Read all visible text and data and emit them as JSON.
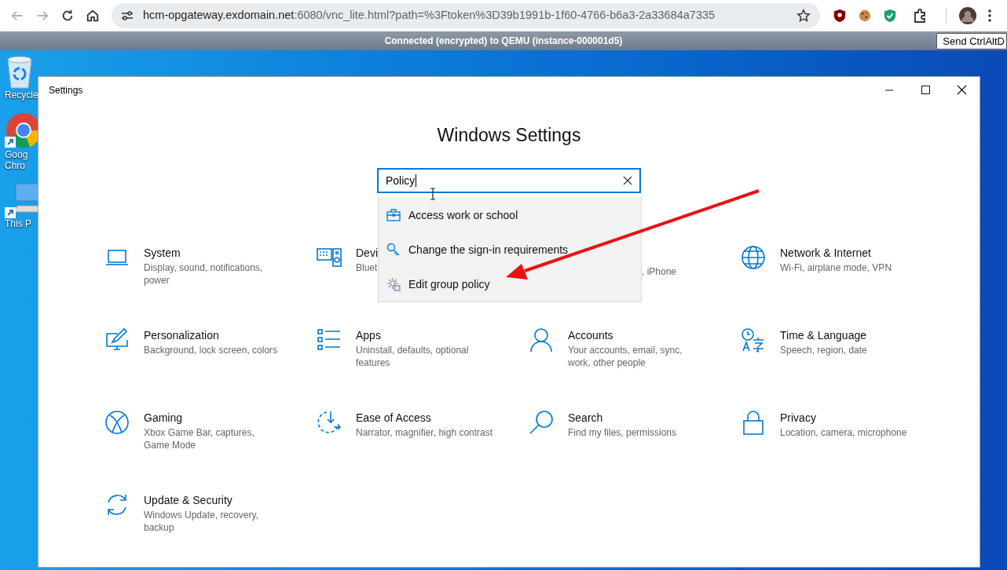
{
  "browser": {
    "url_host": "hcm-opgateway.exdomain.net",
    "url_rest": ":6080/vnc_lite.html?path=%3Ftoken%3D39b1991b-1f60-4766-b6a3-2a33684a7335"
  },
  "vnc": {
    "status": "Connected (encrypted) to QEMU (instance-000001d5)",
    "button": "Send CtrlAltD"
  },
  "desktop_icons": [
    {
      "kind": "recycle",
      "lines": [
        "Recycle"
      ]
    },
    {
      "kind": "chrome",
      "lines": [
        "Goog",
        "Chro"
      ]
    },
    {
      "kind": "pc",
      "lines": [
        "This P"
      ]
    }
  ],
  "window": {
    "title": "Settings",
    "heading": "Windows Settings"
  },
  "search": {
    "value": "Policy",
    "results": [
      {
        "kind": "briefcase",
        "label": "Access work or school"
      },
      {
        "kind": "key",
        "label": "Change the sign-in requirements"
      },
      {
        "kind": "policy",
        "label": "Edit group policy"
      }
    ]
  },
  "tiles": [
    {
      "kind": "system",
      "title": "System",
      "desc": "Display, sound, notifications, power"
    },
    {
      "kind": "devices",
      "title": "Devi",
      "desc": "Bluet"
    },
    {
      "kind": "covered",
      "desc": ", iPhone"
    },
    {
      "kind": "network",
      "title": "Network & Internet",
      "desc": "Wi-Fi, airplane mode, VPN"
    },
    {
      "kind": "personalization",
      "title": "Personalization",
      "desc": "Background, lock screen, colors"
    },
    {
      "kind": "apps",
      "title": "Apps",
      "desc": "Uninstall, defaults, optional features"
    },
    {
      "kind": "accounts",
      "title": "Accounts",
      "desc": "Your accounts, email, sync, work, other people"
    },
    {
      "kind": "time",
      "title": "Time & Language",
      "desc": "Speech, region, date"
    },
    {
      "kind": "gaming",
      "title": "Gaming",
      "desc": "Xbox Game Bar, captures, Game Mode"
    },
    {
      "kind": "ease",
      "title": "Ease of Access",
      "desc": "Narrator, magnifier, high contrast"
    },
    {
      "kind": "search",
      "title": "Search",
      "desc": "Find my files, permissions"
    },
    {
      "kind": "privacy",
      "title": "Privacy",
      "desc": "Location, camera, microphone"
    },
    {
      "kind": "update",
      "title": "Update & Security",
      "desc": "Windows Update, recovery, backup"
    }
  ]
}
